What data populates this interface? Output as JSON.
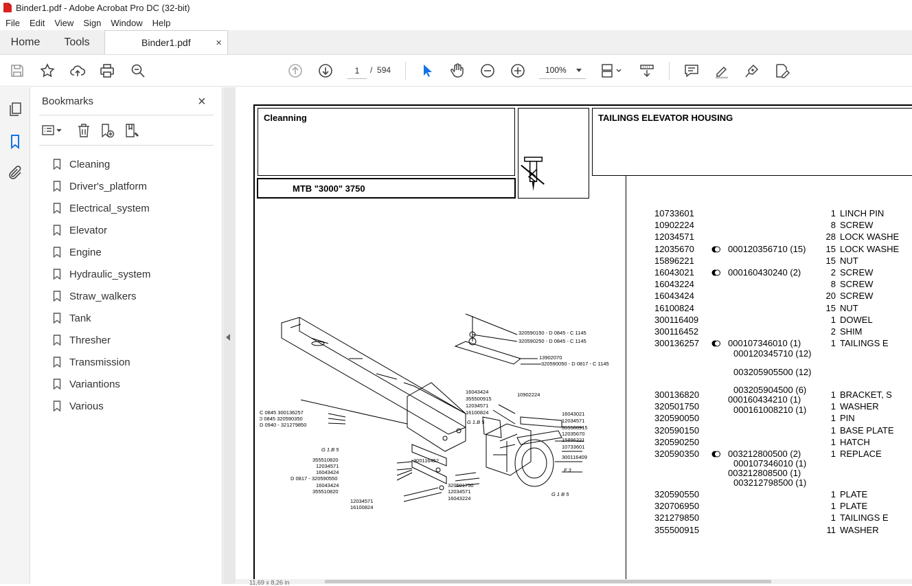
{
  "window": {
    "title": "Binder1.pdf - Adobe Acrobat Pro DC (32-bit)"
  },
  "menu": [
    "File",
    "Edit",
    "View",
    "Sign",
    "Window",
    "Help"
  ],
  "tabs": {
    "home": "Home",
    "tools": "Tools",
    "document": "Binder1.pdf",
    "close": "×"
  },
  "toolbar": {
    "current_page": "1",
    "page_sep": "/",
    "total_pages": "594",
    "zoom": "100%"
  },
  "bookmarks": {
    "title": "Bookmarks",
    "close": "×",
    "items": [
      "Cleaning",
      "Driver's_platform",
      "Electrical_system",
      "Elevator",
      "Engine",
      "Hydraulic_system",
      "Straw_walkers",
      "Tank",
      "Thresher",
      "Transmission",
      "Variantions",
      "Various"
    ]
  },
  "page": {
    "section": "Cleanning",
    "model": "MTB \"3000\" 3750",
    "title": "TAILINGS ELEVATOR HOUSING",
    "parts": [
      {
        "pn": "10733601",
        "qty": "1",
        "desc": "LINCH PIN"
      },
      {
        "pn": "10902224",
        "qty": "8",
        "desc": "SCREW"
      },
      {
        "pn": "12034571",
        "qty": "28",
        "desc": "LOCK WASHE"
      },
      {
        "pn": "12035670",
        "dot": true,
        "ref": "000120356710  (15)",
        "qty": "15",
        "desc": "LOCK WASHE"
      },
      {
        "pn": "15896221",
        "qty": "15",
        "desc": "NUT"
      },
      {
        "pn": "16043021",
        "dot": true,
        "ref": "000160430240  (2)",
        "qty": "2",
        "desc": "SCREW"
      },
      {
        "pn": "16043224",
        "qty": "8",
        "desc": "SCREW"
      },
      {
        "pn": "16043424",
        "qty": "20",
        "desc": "SCREW"
      },
      {
        "pn": "16100824",
        "qty": "15",
        "desc": "NUT"
      },
      {
        "pn": "300116409",
        "qty": "1",
        "desc": "DOWEL"
      },
      {
        "pn": "300116452",
        "qty": "2",
        "desc": "SHIM"
      },
      {
        "pn": "300136257",
        "dot": true,
        "ref": "000107346010  (1)",
        "qty": "1",
        "desc": "TAILINGS E"
      }
    ],
    "subrefs": [
      "000120345710  (12)",
      "003205905500  (12)",
      "003205904500  (6)",
      "000160434210  (1)",
      "000161008210  (1)"
    ],
    "parts2": [
      {
        "pn": "300136820",
        "qty": "1",
        "desc": "BRACKET, S"
      },
      {
        "pn": "320501750",
        "qty": "1",
        "desc": "WASHER"
      },
      {
        "pn": "320590050",
        "qty": "1",
        "desc": "PIN"
      },
      {
        "pn": "320590150",
        "qty": "1",
        "desc": "BASE PLATE"
      },
      {
        "pn": "320590250",
        "qty": "1",
        "desc": "HATCH"
      },
      {
        "pn": "320590350",
        "dot": true,
        "ref": "003212800500  (2)",
        "qty": "1",
        "desc": "REPLACE"
      }
    ],
    "subrefs2": [
      "000107346010  (1)",
      "003212808500  (1)",
      "003212798500  (1)"
    ],
    "parts3": [
      {
        "pn": "320590550",
        "qty": "1",
        "desc": "PLATE"
      },
      {
        "pn": "320706950",
        "qty": "1",
        "desc": "PLATE"
      },
      {
        "pn": "321279850",
        "qty": "1",
        "desc": "TAILINGS E"
      },
      {
        "pn": "355500915",
        "qty": "11",
        "desc": "WASHER"
      }
    ],
    "diagram_labels": {
      "l1": "320590150 - D 0845 - C 1145",
      "l2": "320590250 - D 0845 - C 1145",
      "l3": "13902070",
      "l4": "320590050 - D 0817 - C 1145",
      "l5": "16043424",
      "l6": "355500915",
      "l7": "12034571",
      "l8": "16100824",
      "l9": "10902224",
      "l10": "G 1.B 5",
      "l11": "16043021",
      "l12": "12034571",
      "l13": "355500915",
      "l14": "12035670",
      "l15": "15896221",
      "l16": "10733601",
      "l17": "300116409",
      "l18": "C 0845  300136257",
      "l19": "C 0940 - D 0845  320590350",
      "l20": "D 0940 - 321279850",
      "l21": "G 1.B 5",
      "l22": "355510820",
      "l23": "12034571",
      "l24": "16043424",
      "l25": "D 0817 - 320590550",
      "l26": "16043424",
      "l27": "355510820",
      "l28": "300116452",
      "l29": "320501750",
      "l30": "12034571",
      "l31": "16043224",
      "l32": "12034571",
      "l33": "16100824",
      "l34": "F 3",
      "l35": "G 1 B 5"
    }
  },
  "status": {
    "coords": "11,69 x 8,26 in"
  }
}
